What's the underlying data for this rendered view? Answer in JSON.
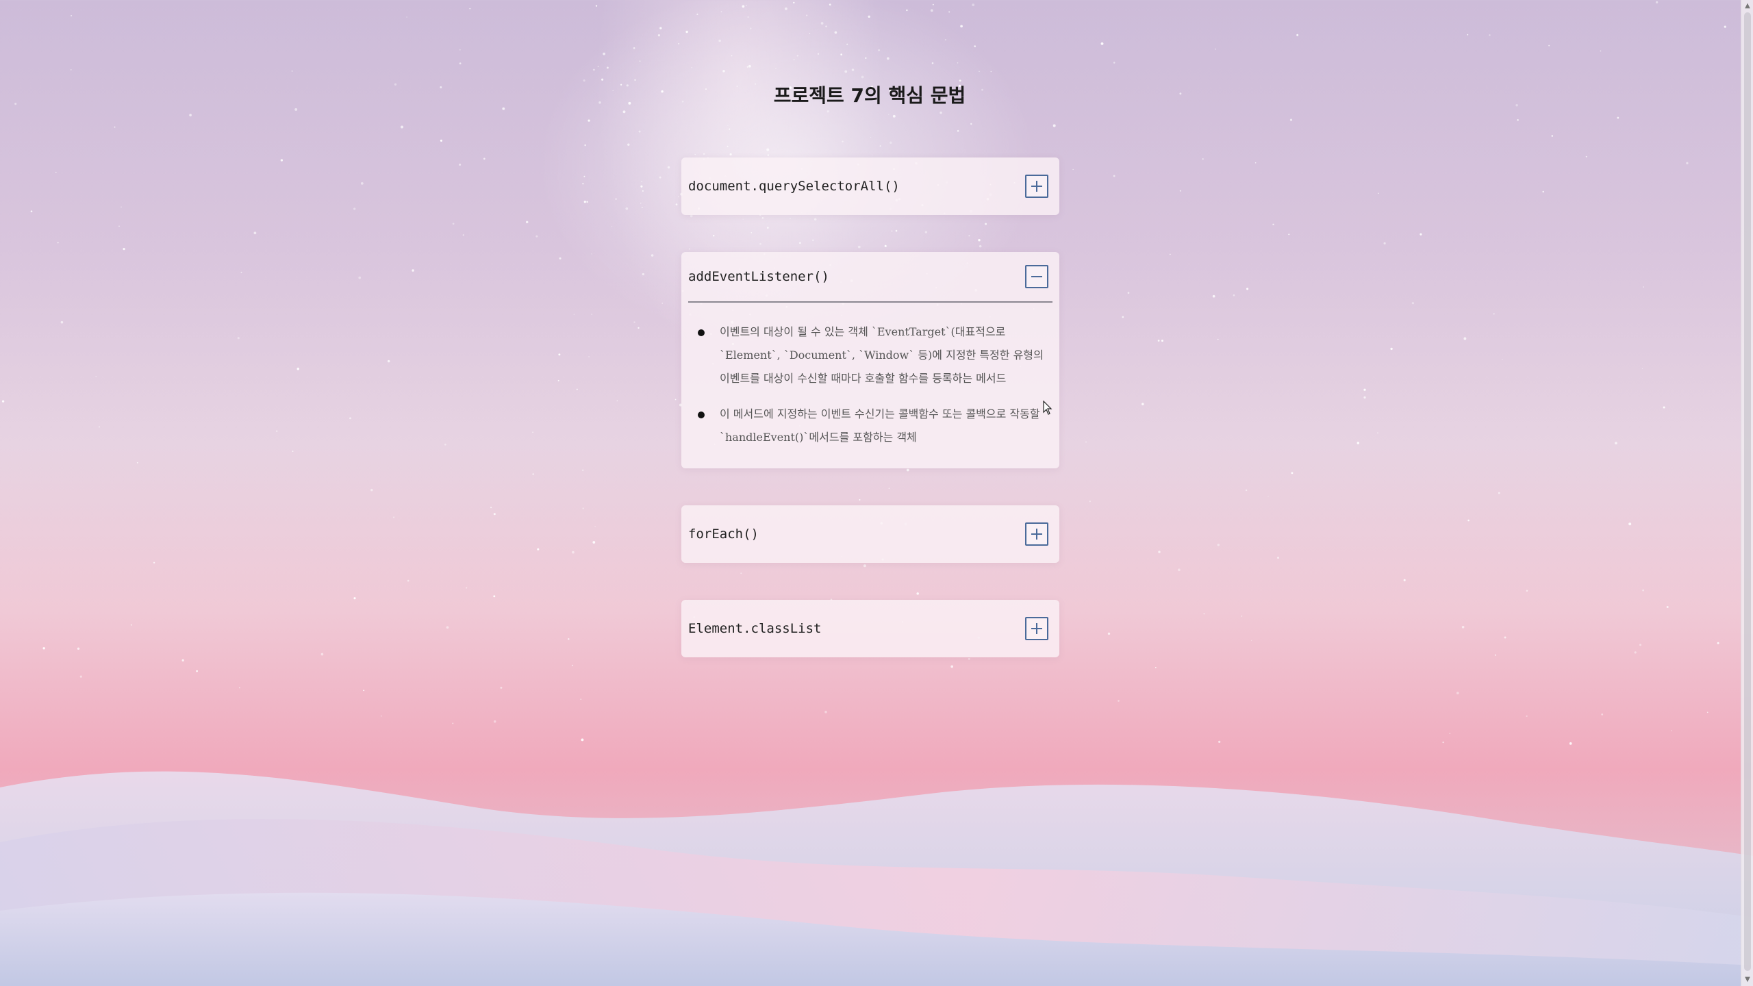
{
  "page": {
    "title": "프로젝트 7의 핵심 문법"
  },
  "accordion": [
    {
      "title": "document.querySelectorAll()",
      "expanded": false,
      "icon": "plus-icon",
      "items": []
    },
    {
      "title": "addEventListener()",
      "expanded": true,
      "icon": "minus-icon",
      "items": [
        "이벤트의 대상이 될 수 있는 객체 `EventTarget`(대표적으로 `Element`, `Document`, `Window` 등)에 지정한 특정한 유형의 이벤트를 대상이 수신할 때마다 호출할 함수를 등록하는 메서드",
        "이 메서드에 지정하는 이벤트 수신기는 콜백함수 또는 콜백으로 작동할 `handleEvent()`메서드를 포함하는 객체"
      ]
    },
    {
      "title": "forEach()",
      "expanded": false,
      "icon": "plus-icon",
      "items": []
    },
    {
      "title": "Element.classList",
      "expanded": false,
      "icon": "plus-icon",
      "items": []
    }
  ],
  "colors": {
    "toggle_border": "#4a6a9a",
    "card_background": "#faf0f5",
    "sky_top": "#cdbcd9",
    "horizon_pink": "#f0a9bc"
  }
}
